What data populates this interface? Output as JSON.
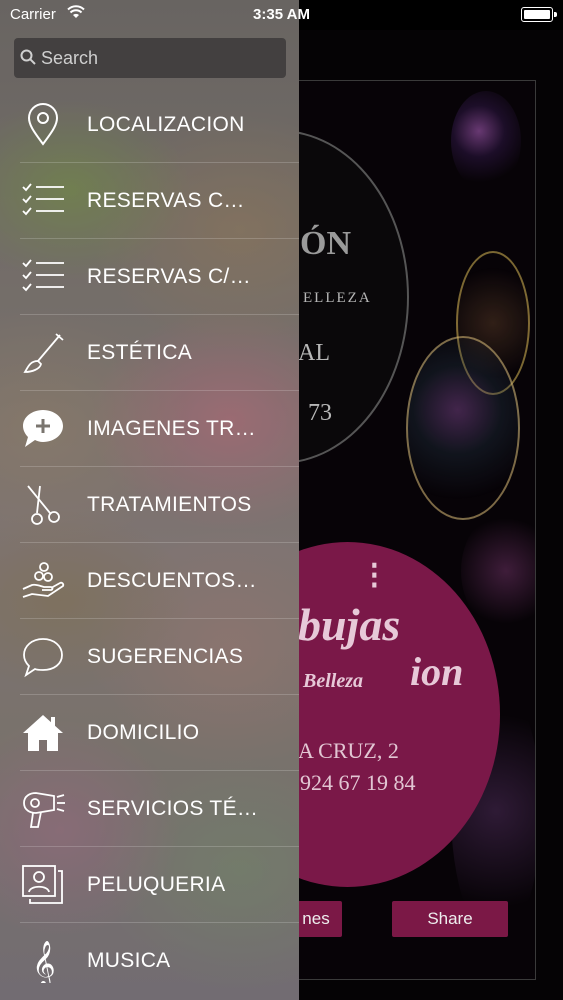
{
  "status_bar": {
    "carrier": "Carrier",
    "time": "3:35 AM"
  },
  "search": {
    "placeholder": "Search"
  },
  "menu": {
    "items": [
      {
        "label": "LOCALIZACION",
        "icon": "location-pin-icon"
      },
      {
        "label": "RESERVAS C…",
        "icon": "checklist-icon"
      },
      {
        "label": "RESERVAS C/…",
        "icon": "checklist-icon"
      },
      {
        "label": "ESTÉTICA",
        "icon": "brush-icon"
      },
      {
        "label": "IMAGENES TR…",
        "icon": "speech-bubble-plus-icon"
      },
      {
        "label": "TRATAMIENTOS",
        "icon": "scissors-icon"
      },
      {
        "label": "DESCUENTOS…",
        "icon": "coins-hand-icon"
      },
      {
        "label": "SUGERENCIAS",
        "icon": "chat-bubble-icon"
      },
      {
        "label": "DOMICILIO",
        "icon": "home-icon"
      },
      {
        "label": "SERVICIOS TÉ…",
        "icon": "hair-dryer-icon"
      },
      {
        "label": "PELUQUERIA",
        "icon": "photo-stack-icon"
      },
      {
        "label": "MUSICA",
        "icon": "treble-clef-icon"
      }
    ]
  },
  "background": {
    "top_circle_word": "ÓN",
    "top_circle_sub": "ELLEZA",
    "top_circle_letters": "AL",
    "top_circle_number": "73",
    "brand_script": "bujas",
    "brand_script_2": "ion",
    "brand_tagline": "Belleza",
    "address": "A CRUZ, 2",
    "phone": "924 67 19 84",
    "button_left": "nes",
    "button_right": "Share"
  },
  "colors": {
    "accent": "#7b1846",
    "drawer_text": "#ffffff"
  }
}
